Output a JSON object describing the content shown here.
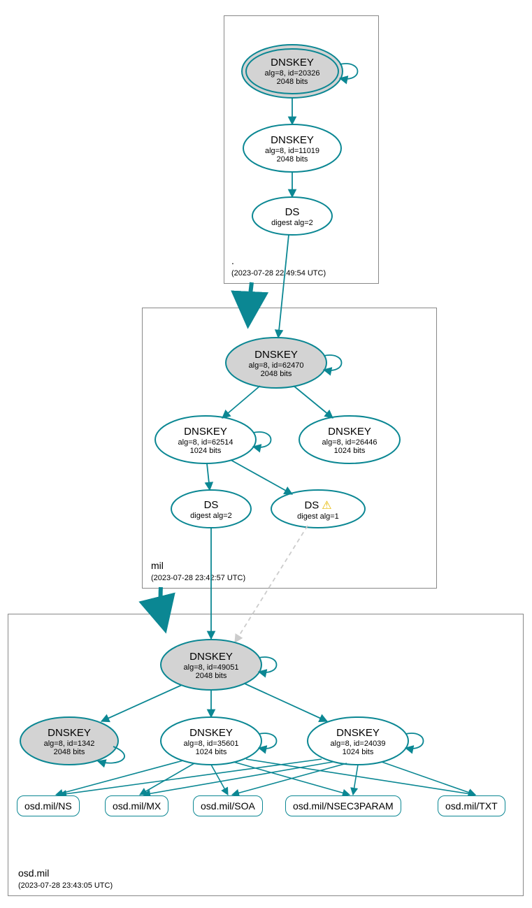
{
  "colors": {
    "teal": "#0b8793",
    "fill_grey": "#d3d3d3",
    "light_grey": "#cccccc"
  },
  "zones": {
    "root": {
      "name": ".",
      "time": "(2023-07-28 22:49:54 UTC)"
    },
    "mil": {
      "name": "mil",
      "time": "(2023-07-28 23:42:57 UTC)"
    },
    "osd": {
      "name": "osd.mil",
      "time": "(2023-07-28 23:43:05 UTC)"
    }
  },
  "nodes": {
    "root_ksk": {
      "title": "DNSKEY",
      "sub1": "alg=8, id=20326",
      "sub2": "2048 bits"
    },
    "root_zsk": {
      "title": "DNSKEY",
      "sub1": "alg=8, id=11019",
      "sub2": "2048 bits"
    },
    "root_ds": {
      "title": "DS",
      "sub1": "digest alg=2"
    },
    "mil_ksk": {
      "title": "DNSKEY",
      "sub1": "alg=8, id=62470",
      "sub2": "2048 bits"
    },
    "mil_zsk1": {
      "title": "DNSKEY",
      "sub1": "alg=8, id=62514",
      "sub2": "1024 bits"
    },
    "mil_zsk2": {
      "title": "DNSKEY",
      "sub1": "alg=8, id=26446",
      "sub2": "1024 bits"
    },
    "mil_ds2": {
      "title": "DS",
      "sub1": "digest alg=2"
    },
    "mil_ds1": {
      "title": "DS",
      "sub1": "digest alg=1",
      "warn": true
    },
    "osd_ksk": {
      "title": "DNSKEY",
      "sub1": "alg=8, id=49051",
      "sub2": "2048 bits"
    },
    "osd_key_g": {
      "title": "DNSKEY",
      "sub1": "alg=8, id=1342",
      "sub2": "2048 bits"
    },
    "osd_zsk1": {
      "title": "DNSKEY",
      "sub1": "alg=8, id=35601",
      "sub2": "1024 bits"
    },
    "osd_zsk2": {
      "title": "DNSKEY",
      "sub1": "alg=8, id=24039",
      "sub2": "1024 bits"
    }
  },
  "rrsets": {
    "ns": "osd.mil/NS",
    "mx": "osd.mil/MX",
    "soa": "osd.mil/SOA",
    "nsec": "osd.mil/NSEC3PARAM",
    "txt": "osd.mil/TXT"
  },
  "warn_glyph": "⚠"
}
